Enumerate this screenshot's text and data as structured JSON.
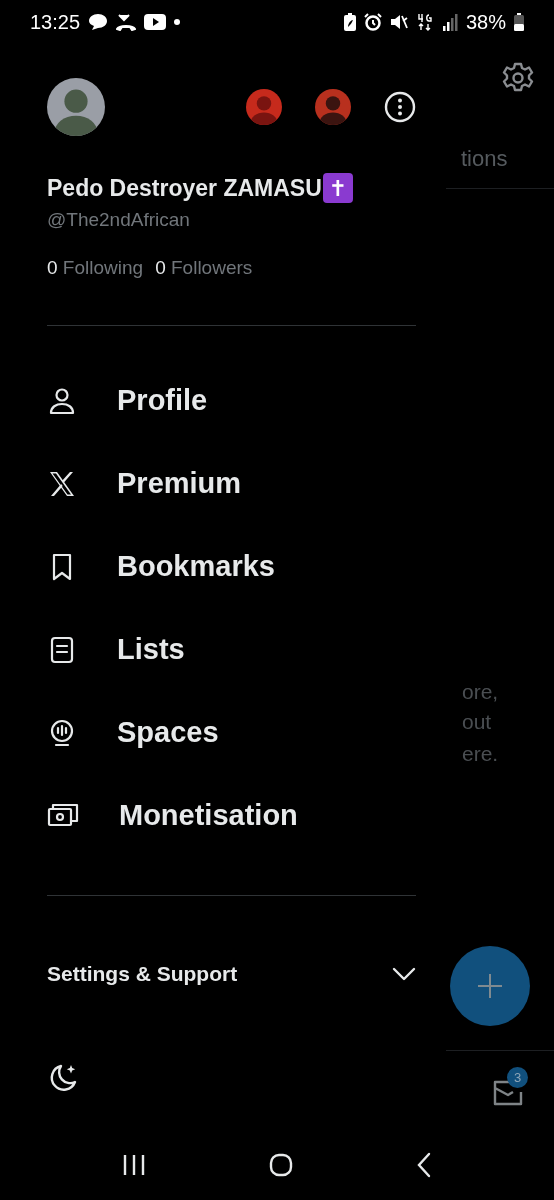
{
  "status_bar": {
    "time": "13:25",
    "battery": "38%"
  },
  "account": {
    "name": "Pedo Destroyer ZAMASU",
    "name_emoji": "✝",
    "handle": "@The2ndAfrican",
    "following_count": "0",
    "following_label": "Following",
    "followers_count": "0",
    "followers_label": "Followers"
  },
  "menu": [
    {
      "kind": "profile",
      "label": "Profile"
    },
    {
      "kind": "premium",
      "label": "Premium"
    },
    {
      "kind": "bookmarks",
      "label": "Bookmarks"
    },
    {
      "kind": "lists",
      "label": "Lists"
    },
    {
      "kind": "spaces",
      "label": "Spaces"
    },
    {
      "kind": "monetisation",
      "label": "Monetisation"
    }
  ],
  "settings_section": {
    "label": "Settings & Support",
    "expanded": false
  },
  "background": {
    "tab_fragment": "tions",
    "message_lines": [
      "ore,",
      "out",
      "ere."
    ],
    "unread_badge": "3"
  }
}
